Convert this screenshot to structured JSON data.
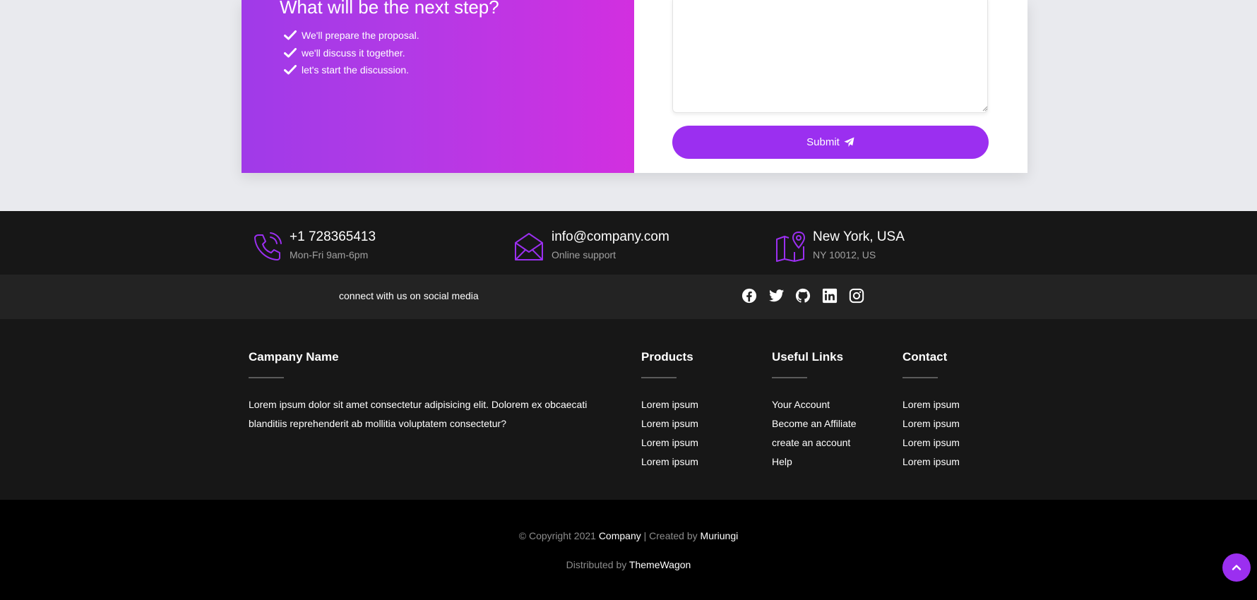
{
  "next_steps": {
    "heading": "What will be the next step?",
    "items": [
      {
        "text": "We'll prepare the proposal."
      },
      {
        "text": "we'll discuss it together."
      },
      {
        "text": "let's start the discussion."
      }
    ]
  },
  "form": {
    "message_value": "",
    "submit_label": "Submit"
  },
  "contact_info": [
    {
      "icon": "phone-icon",
      "title": "+1 728365413",
      "subtitle": "Mon-Fri 9am-6pm"
    },
    {
      "icon": "envelope-icon",
      "title": "info@company.com",
      "subtitle": "Online support"
    },
    {
      "icon": "map-pin-icon",
      "title": "New York, USA",
      "subtitle": "NY 10012, US"
    }
  ],
  "social": {
    "text": "connect with us on social media",
    "icons": [
      "facebook-icon",
      "twitter-icon",
      "github-icon",
      "linkedin-icon",
      "instagram-icon"
    ]
  },
  "footer": {
    "company": {
      "title": "Campany Name",
      "text": "Lorem ipsum dolor sit amet consectetur adipisicing elit. Dolorem ex obcaecati blanditiis reprehenderit ab mollitia voluptatem consectetur?"
    },
    "products": {
      "title": "Products",
      "items": [
        "Lorem ipsum",
        "Lorem ipsum",
        "Lorem ipsum",
        "Lorem ipsum"
      ]
    },
    "useful_links": {
      "title": "Useful Links",
      "items": [
        "Your Account",
        "Become an Affiliate",
        "create an account",
        "Help"
      ]
    },
    "contact": {
      "title": "Contact",
      "items": [
        "Lorem ipsum",
        "Lorem ipsum",
        "Lorem ipsum",
        "Lorem ipsum"
      ]
    }
  },
  "bottom": {
    "copyright_prefix": "© Copyright 2021",
    "company_link": "Company",
    "created_by_text": "| Created by",
    "author_link": "Muriungi",
    "distributed_prefix": "Distributed by",
    "distributor_link": "ThemeWagon"
  },
  "colors": {
    "accent": "#9b2ff0",
    "gradient_start": "#a03ae8",
    "gradient_end": "#d22fe0",
    "footer_bg": "#171717",
    "social_bg": "#232323",
    "bottom_bg": "#000000"
  },
  "back_to_top_icon": "chevron-up-icon"
}
